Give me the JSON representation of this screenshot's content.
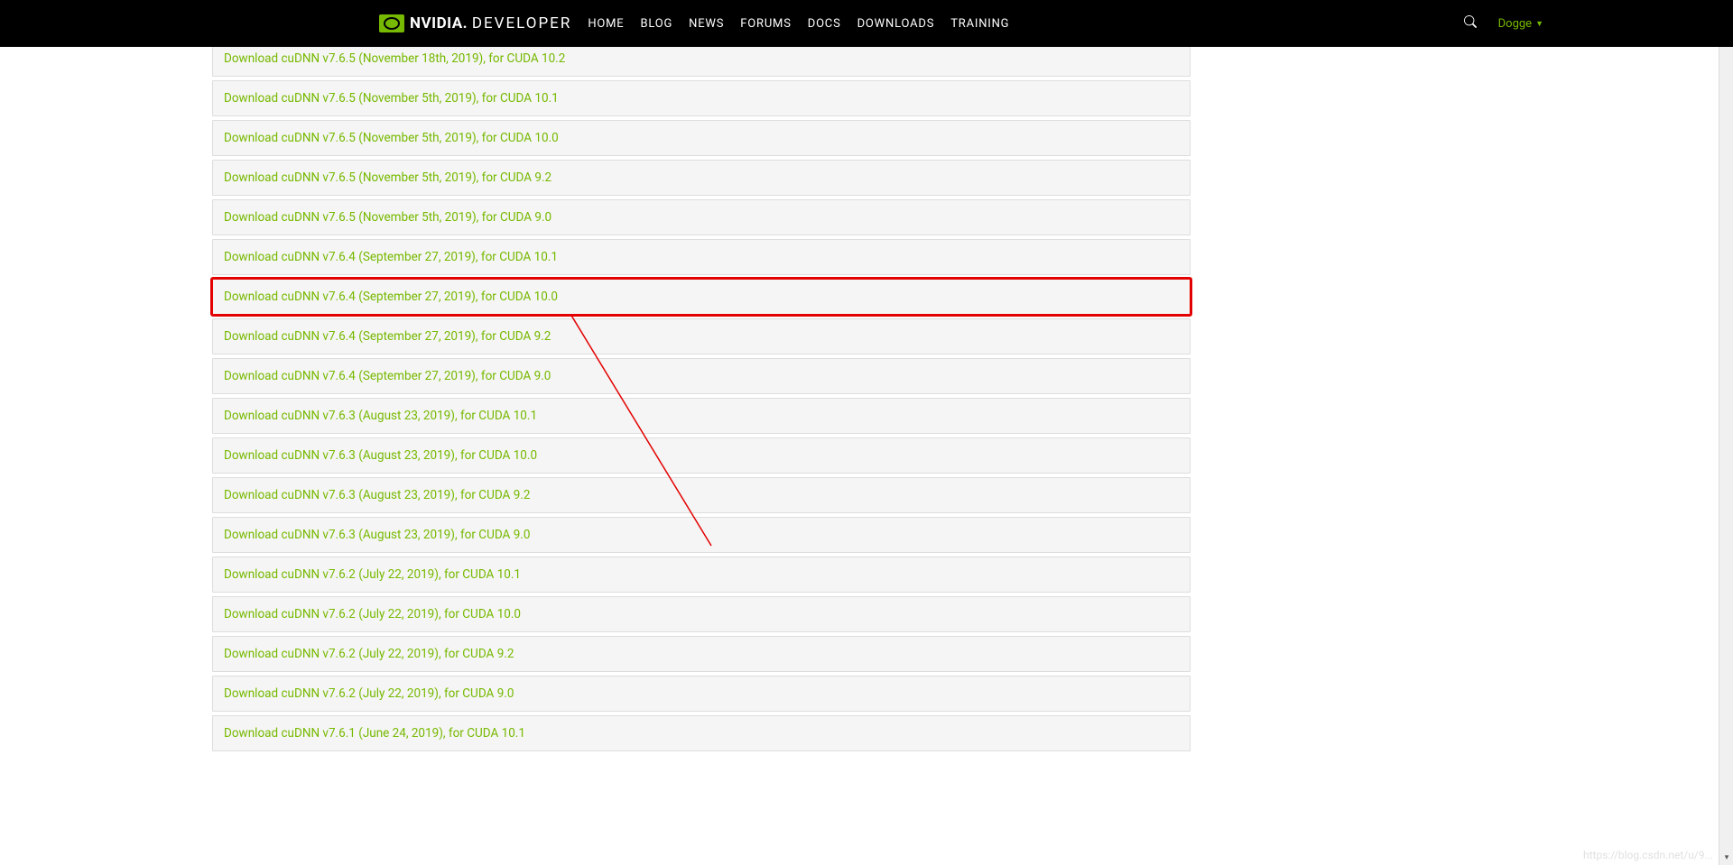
{
  "navbar": {
    "logo_brand": "NVIDIA",
    "logo_sub": "DEVELOPER",
    "links": [
      "HOME",
      "BLOG",
      "NEWS",
      "FORUMS",
      "DOCS",
      "DOWNLOADS",
      "TRAINING"
    ],
    "user_name": "Dogge"
  },
  "downloads": [
    {
      "label": "Download cuDNN v7.6.5 (November 18th, 2019), for CUDA 10.2",
      "partial": true,
      "highlighted": false
    },
    {
      "label": "Download cuDNN v7.6.5 (November 5th, 2019), for CUDA 10.1",
      "partial": false,
      "highlighted": false
    },
    {
      "label": "Download cuDNN v7.6.5 (November 5th, 2019), for CUDA 10.0",
      "partial": false,
      "highlighted": false
    },
    {
      "label": "Download cuDNN v7.6.5 (November 5th, 2019), for CUDA 9.2",
      "partial": false,
      "highlighted": false
    },
    {
      "label": "Download cuDNN v7.6.5 (November 5th, 2019), for CUDA 9.0",
      "partial": false,
      "highlighted": false
    },
    {
      "label": "Download cuDNN v7.6.4 (September 27, 2019), for CUDA 10.1",
      "partial": false,
      "highlighted": false
    },
    {
      "label": "Download cuDNN v7.6.4 (September 27, 2019), for CUDA 10.0",
      "partial": false,
      "highlighted": true
    },
    {
      "label": "Download cuDNN v7.6.4 (September 27, 2019), for CUDA 9.2",
      "partial": false,
      "highlighted": false
    },
    {
      "label": "Download cuDNN v7.6.4 (September 27, 2019), for CUDA 9.0",
      "partial": false,
      "highlighted": false
    },
    {
      "label": "Download cuDNN v7.6.3 (August 23, 2019), for CUDA 10.1",
      "partial": false,
      "highlighted": false
    },
    {
      "label": "Download cuDNN v7.6.3 (August 23, 2019), for CUDA 10.0",
      "partial": false,
      "highlighted": false
    },
    {
      "label": "Download cuDNN v7.6.3 (August 23, 2019), for CUDA 9.2",
      "partial": false,
      "highlighted": false
    },
    {
      "label": "Download cuDNN v7.6.3 (August 23, 2019), for CUDA 9.0",
      "partial": false,
      "highlighted": false
    },
    {
      "label": "Download cuDNN v7.6.2 (July 22, 2019), for CUDA 10.1",
      "partial": false,
      "highlighted": false
    },
    {
      "label": "Download cuDNN v7.6.2 (July 22, 2019), for CUDA 10.0",
      "partial": false,
      "highlighted": false
    },
    {
      "label": "Download cuDNN v7.6.2 (July 22, 2019), for CUDA 9.2",
      "partial": false,
      "highlighted": false
    },
    {
      "label": "Download cuDNN v7.6.2 (July 22, 2019), for CUDA 9.0",
      "partial": false,
      "highlighted": false
    },
    {
      "label": "Download cuDNN v7.6.1 (June 24, 2019), for CUDA 10.1",
      "partial": false,
      "highlighted": false
    }
  ],
  "watermark": "https://blog.csdn.net/u/9..."
}
